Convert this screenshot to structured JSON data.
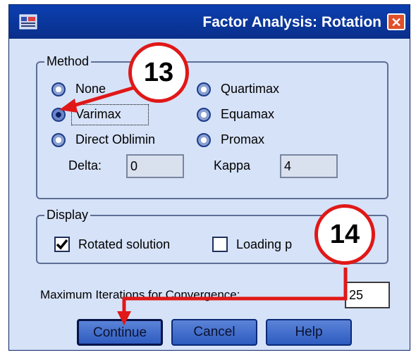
{
  "window": {
    "title": "Factor Analysis: Rotation",
    "close_glyph": "✕"
  },
  "method": {
    "legend": "Method",
    "options": [
      {
        "label": "None",
        "selected": false
      },
      {
        "label": "Varimax",
        "selected": true
      },
      {
        "label": "Direct Oblimin",
        "selected": false
      },
      {
        "label": "Quartimax",
        "selected": false
      },
      {
        "label": "Equamax",
        "selected": false
      },
      {
        "label": "Promax",
        "selected": false
      }
    ],
    "delta_label": "Delta:",
    "delta_value": "0",
    "kappa_label": "Kappa",
    "kappa_value": "4"
  },
  "display": {
    "legend": "Display",
    "rotated_solution_label": "Rotated solution",
    "rotated_solution_checked": true,
    "loading_plots_label": "Loading p",
    "loading_plots_checked": false
  },
  "iterations": {
    "label": "Maximum Iterations for Convergence:",
    "value": "25"
  },
  "buttons": {
    "continue": "Continue",
    "cancel": "Cancel",
    "help": "Help"
  },
  "annotations": {
    "step1": "13",
    "step2": "14",
    "color": "#e01818"
  }
}
